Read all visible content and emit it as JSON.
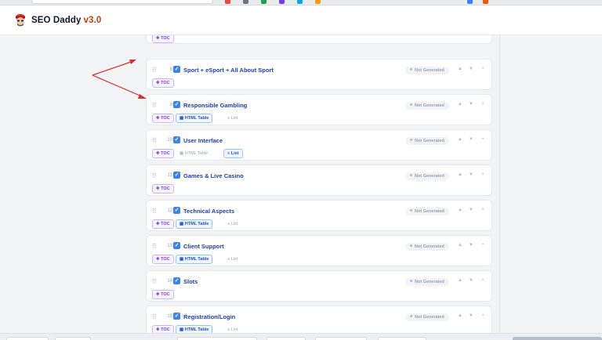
{
  "header": {
    "app_name": "SEO Daddy",
    "version": "v3.0",
    "logo_icon": "mascot-logo"
  },
  "sections": [
    {
      "index": "",
      "title": "",
      "status": "",
      "checked": true,
      "toc": "TOC",
      "html_table": null,
      "list": null
    },
    {
      "index": "8",
      "title": "Sport + eSport + All About Sport",
      "status": "Not Generated",
      "checked": true,
      "toc": "TOC",
      "html_table": null,
      "list": null
    },
    {
      "index": "9",
      "title": "Responsible Gambling",
      "status": "Not Generated",
      "checked": true,
      "toc": "TOC",
      "html_table": {
        "label": "HTML Table",
        "active": true
      },
      "list": {
        "label": "List",
        "active": false
      }
    },
    {
      "index": "10",
      "title": "User Interface",
      "status": "Not Generated",
      "checked": true,
      "toc": "TOC",
      "html_table": {
        "label": "HTML Table",
        "active": false
      },
      "list": {
        "label": "List",
        "active": true
      }
    },
    {
      "index": "11",
      "title": "Games & Live Casino",
      "status": "Not Generated",
      "checked": true,
      "toc": "TOC",
      "html_table": null,
      "list": null
    },
    {
      "index": "12",
      "title": "Technical Aspects",
      "status": "Not Generated",
      "checked": true,
      "toc": "TOC",
      "html_table": {
        "label": "HTML Table",
        "active": true
      },
      "list": {
        "label": "List",
        "active": false
      }
    },
    {
      "index": "13",
      "title": "Client Support",
      "status": "Not Generated",
      "checked": true,
      "toc": "TOC",
      "html_table": {
        "label": "HTML Table",
        "active": true
      },
      "list": {
        "label": "List",
        "active": false
      }
    },
    {
      "index": "14",
      "title": "Slots",
      "status": "Not Generated",
      "checked": true,
      "toc": "TOC",
      "html_table": null,
      "list": null
    },
    {
      "index": "15",
      "title": "Registration/Login",
      "status": "Not Generated",
      "checked": true,
      "toc": "TOC",
      "html_table": {
        "label": "HTML Table",
        "active": true
      },
      "list": {
        "label": "List",
        "active": false
      }
    }
  ],
  "icons": {
    "drag": "drag-handle-icon",
    "move_up": "arrow-up-icon",
    "move_down": "arrow-down-icon",
    "more": "more-icon"
  },
  "colors": {
    "accent": "#3b82f6",
    "title": "#1e40af",
    "version": "#c2410c",
    "toc": "#7c3aed",
    "annotation": "#d32f2f"
  }
}
